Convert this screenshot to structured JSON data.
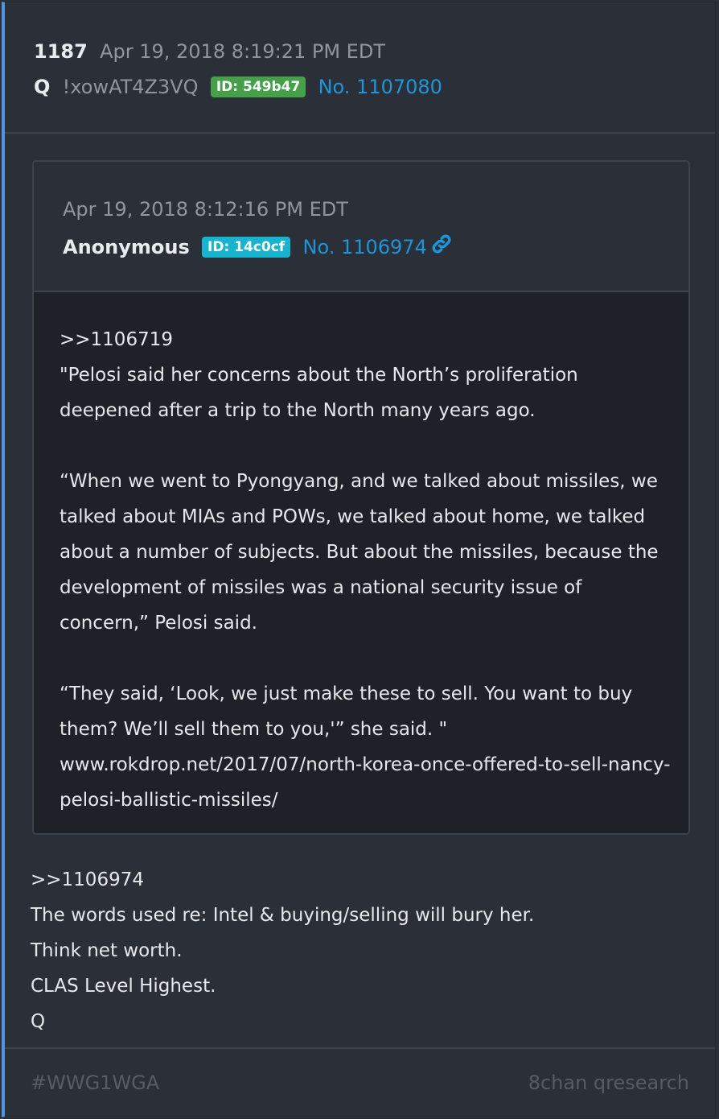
{
  "post": {
    "number": "1187",
    "date": "Apr 19, 2018 8:19:21 PM EDT",
    "author": "Q",
    "tripcode": "!xowAT4Z3VQ",
    "id_badge": "ID: 549b47",
    "post_no": "No. 1107080"
  },
  "quoted": {
    "date": "Apr 19, 2018 8:12:16 PM EDT",
    "author": "Anonymous",
    "id_badge": "ID: 14c0cf",
    "post_no": "No. 1106974",
    "body_lines": [
      ">>1106719",
      "\"Pelosi said her concerns about the North’s proliferation deepened after a trip to the North many years ago.",
      "",
      "“When we went to Pyongyang, and we talked about missiles, we talked about MIAs and POWs, we talked about home, we talked about a number of subjects. But about the missiles, because the development of missiles was a national security issue of concern,” Pelosi said.",
      "",
      "“They said, ‘Look, we just make these to sell. You want to buy them? We’ll sell them to you,'” she said. \"",
      "www.rokdrop.net/2017/07/north-korea-once-offered-to-sell-nancy-pelosi-ballistic-missiles/"
    ]
  },
  "reply_lines": [
    ">>1106974",
    "The words used re: Intel & buying/selling will bury her.",
    "Think net worth.",
    "CLAS Level Highest.",
    "Q"
  ],
  "footer": {
    "tag": "#WWG1WGA",
    "source": "8chan qresearch"
  },
  "colors": {
    "accent": "#4f95e3",
    "link": "#1e95d8",
    "id_green": "#45a049",
    "id_cyan": "#17b3cf"
  },
  "icons": {
    "quoted_link": "link-icon"
  }
}
